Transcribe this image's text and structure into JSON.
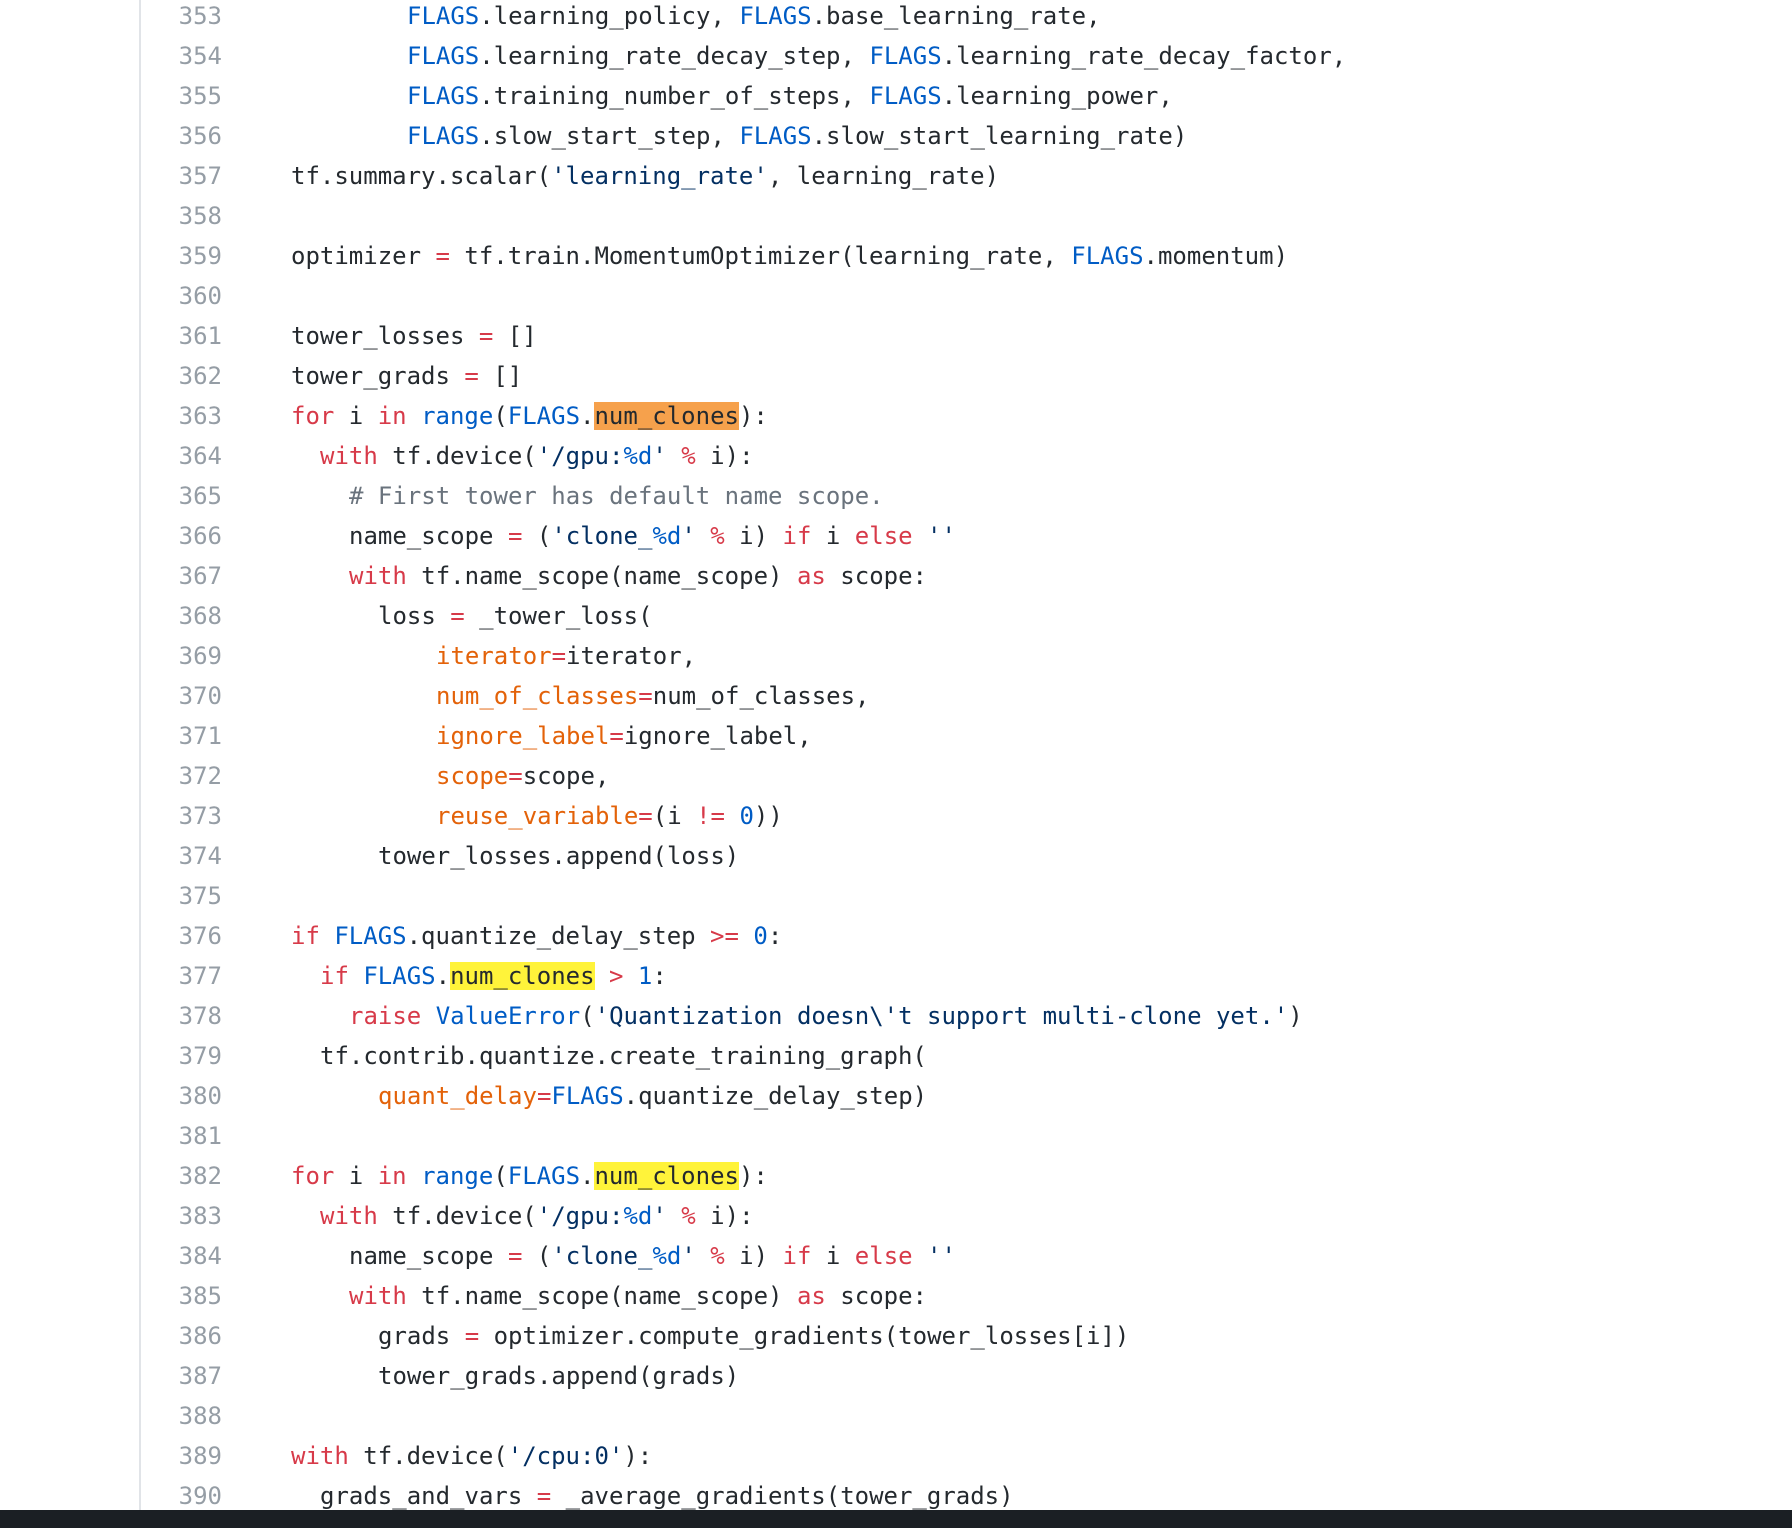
{
  "code_view": {
    "lines": [
      {
        "num": "353",
        "indent": 4,
        "tokens": [
          [
            "n",
            "FLAGS"
          ],
          [
            "",
            "."
          ],
          [
            "",
            "learning_policy, "
          ],
          [
            "n",
            "FLAGS"
          ],
          [
            "",
            ".base_learning_rate,"
          ]
        ]
      },
      {
        "num": "354",
        "indent": 4,
        "tokens": [
          [
            "n",
            "FLAGS"
          ],
          [
            "",
            ".learning_rate_decay_step, "
          ],
          [
            "n",
            "FLAGS"
          ],
          [
            "",
            ".learning_rate_decay_factor,"
          ]
        ]
      },
      {
        "num": "355",
        "indent": 4,
        "tokens": [
          [
            "n",
            "FLAGS"
          ],
          [
            "",
            ".training_number_of_steps, "
          ],
          [
            "n",
            "FLAGS"
          ],
          [
            "",
            ".learning_power,"
          ]
        ]
      },
      {
        "num": "356",
        "indent": 4,
        "tokens": [
          [
            "n",
            "FLAGS"
          ],
          [
            "",
            ".slow_start_step, "
          ],
          [
            "n",
            "FLAGS"
          ],
          [
            "",
            ".slow_start_learning_rate)"
          ]
        ]
      },
      {
        "num": "357",
        "indent": 0,
        "tokens": [
          [
            "",
            "tf.summary.scalar("
          ],
          [
            "s",
            "'learning_rate'"
          ],
          [
            "",
            ", learning_rate)"
          ]
        ]
      },
      {
        "num": "358",
        "indent": 0,
        "tokens": []
      },
      {
        "num": "359",
        "indent": 0,
        "tokens": [
          [
            "",
            "optimizer "
          ],
          [
            "k",
            "="
          ],
          [
            "",
            " tf.train.MomentumOptimizer(learning_rate, "
          ],
          [
            "n",
            "FLAGS"
          ],
          [
            "",
            ".momentum)"
          ]
        ]
      },
      {
        "num": "360",
        "indent": 0,
        "tokens": []
      },
      {
        "num": "361",
        "indent": 0,
        "tokens": [
          [
            "",
            "tower_losses "
          ],
          [
            "k",
            "="
          ],
          [
            "",
            " []"
          ]
        ]
      },
      {
        "num": "362",
        "indent": 0,
        "tokens": [
          [
            "",
            "tower_grads "
          ],
          [
            "k",
            "="
          ],
          [
            "",
            " []"
          ]
        ]
      },
      {
        "num": "363",
        "indent": 0,
        "tokens": [
          [
            "k",
            "for"
          ],
          [
            "",
            " i "
          ],
          [
            "k",
            "in"
          ],
          [
            "",
            " "
          ],
          [
            "n",
            "range"
          ],
          [
            "",
            "("
          ],
          [
            "n",
            "FLAGS"
          ],
          [
            "",
            "."
          ],
          [
            "hl-o",
            "num_clones"
          ],
          [
            "",
            "):"
          ]
        ]
      },
      {
        "num": "364",
        "indent": 1,
        "tokens": [
          [
            "k",
            "with"
          ],
          [
            "",
            " tf.device("
          ],
          [
            "s",
            "'/gpu:"
          ],
          [
            "n",
            "%d"
          ],
          [
            "s",
            "'"
          ],
          [
            "",
            " "
          ],
          [
            "k",
            "%"
          ],
          [
            "",
            " i):"
          ]
        ]
      },
      {
        "num": "365",
        "indent": 2,
        "tokens": [
          [
            "c",
            "# First tower has default name scope."
          ]
        ]
      },
      {
        "num": "366",
        "indent": 2,
        "tokens": [
          [
            "",
            "name_scope "
          ],
          [
            "k",
            "="
          ],
          [
            "",
            " ("
          ],
          [
            "s",
            "'clone_"
          ],
          [
            "n",
            "%d"
          ],
          [
            "s",
            "'"
          ],
          [
            "",
            " "
          ],
          [
            "k",
            "%"
          ],
          [
            "",
            " i) "
          ],
          [
            "k",
            "if"
          ],
          [
            "",
            " i "
          ],
          [
            "k",
            "else"
          ],
          [
            "",
            " "
          ],
          [
            "s",
            "''"
          ]
        ]
      },
      {
        "num": "367",
        "indent": 2,
        "tokens": [
          [
            "k",
            "with"
          ],
          [
            "",
            " tf.name_scope(name_scope) "
          ],
          [
            "k",
            "as"
          ],
          [
            "",
            " scope:"
          ]
        ]
      },
      {
        "num": "368",
        "indent": 3,
        "tokens": [
          [
            "",
            "loss "
          ],
          [
            "k",
            "="
          ],
          [
            "",
            " _tower_loss("
          ]
        ]
      },
      {
        "num": "369",
        "indent": 5,
        "tokens": [
          [
            "p",
            "iterator"
          ],
          [
            "k",
            "="
          ],
          [
            "",
            "iterator,"
          ]
        ]
      },
      {
        "num": "370",
        "indent": 5,
        "tokens": [
          [
            "p",
            "num_of_classes"
          ],
          [
            "k",
            "="
          ],
          [
            "",
            "num_of_classes,"
          ]
        ]
      },
      {
        "num": "371",
        "indent": 5,
        "tokens": [
          [
            "p",
            "ignore_label"
          ],
          [
            "k",
            "="
          ],
          [
            "",
            "ignore_label,"
          ]
        ]
      },
      {
        "num": "372",
        "indent": 5,
        "tokens": [
          [
            "p",
            "scope"
          ],
          [
            "k",
            "="
          ],
          [
            "",
            "scope,"
          ]
        ]
      },
      {
        "num": "373",
        "indent": 5,
        "tokens": [
          [
            "p",
            "reuse_variable"
          ],
          [
            "k",
            "="
          ],
          [
            "",
            "(i "
          ],
          [
            "k",
            "!="
          ],
          [
            "",
            " "
          ],
          [
            "n",
            "0"
          ],
          [
            "",
            "))"
          ]
        ]
      },
      {
        "num": "374",
        "indent": 3,
        "tokens": [
          [
            "",
            "tower_losses.append(loss)"
          ]
        ]
      },
      {
        "num": "375",
        "indent": 0,
        "tokens": []
      },
      {
        "num": "376",
        "indent": 0,
        "tokens": [
          [
            "k",
            "if"
          ],
          [
            "",
            " "
          ],
          [
            "n",
            "FLAGS"
          ],
          [
            "",
            ".quantize_delay_step "
          ],
          [
            "k",
            ">="
          ],
          [
            "",
            " "
          ],
          [
            "n",
            "0"
          ],
          [
            "",
            ":"
          ]
        ]
      },
      {
        "num": "377",
        "indent": 1,
        "tokens": [
          [
            "k",
            "if"
          ],
          [
            "",
            " "
          ],
          [
            "n",
            "FLAGS"
          ],
          [
            "",
            "."
          ],
          [
            "hl-y",
            "num_clones"
          ],
          [
            "",
            " "
          ],
          [
            "k",
            ">"
          ],
          [
            "",
            " "
          ],
          [
            "n",
            "1"
          ],
          [
            "",
            ":"
          ]
        ]
      },
      {
        "num": "378",
        "indent": 2,
        "tokens": [
          [
            "k",
            "raise"
          ],
          [
            "",
            " "
          ],
          [
            "n",
            "ValueError"
          ],
          [
            "",
            "("
          ],
          [
            "s",
            "'Quantization doesn\\'t support multi-clone yet.'"
          ],
          [
            "",
            ")"
          ]
        ]
      },
      {
        "num": "379",
        "indent": 1,
        "tokens": [
          [
            "",
            "tf.contrib.quantize.create_training_graph("
          ]
        ]
      },
      {
        "num": "380",
        "indent": 3,
        "tokens": [
          [
            "p",
            "quant_delay"
          ],
          [
            "k",
            "="
          ],
          [
            "n",
            "FLAGS"
          ],
          [
            "",
            ".quantize_delay_step)"
          ]
        ]
      },
      {
        "num": "381",
        "indent": 0,
        "tokens": []
      },
      {
        "num": "382",
        "indent": 0,
        "tokens": [
          [
            "k",
            "for"
          ],
          [
            "",
            " i "
          ],
          [
            "k",
            "in"
          ],
          [
            "",
            " "
          ],
          [
            "n",
            "range"
          ],
          [
            "",
            "("
          ],
          [
            "n",
            "FLAGS"
          ],
          [
            "",
            "."
          ],
          [
            "hl-y",
            "num_clones"
          ],
          [
            "",
            "):"
          ]
        ]
      },
      {
        "num": "383",
        "indent": 1,
        "tokens": [
          [
            "k",
            "with"
          ],
          [
            "",
            " tf.device("
          ],
          [
            "s",
            "'/gpu:"
          ],
          [
            "n",
            "%d"
          ],
          [
            "s",
            "'"
          ],
          [
            "",
            " "
          ],
          [
            "k",
            "%"
          ],
          [
            "",
            " i):"
          ]
        ]
      },
      {
        "num": "384",
        "indent": 2,
        "tokens": [
          [
            "",
            "name_scope "
          ],
          [
            "k",
            "="
          ],
          [
            "",
            " ("
          ],
          [
            "s",
            "'clone_"
          ],
          [
            "n",
            "%d"
          ],
          [
            "s",
            "'"
          ],
          [
            "",
            " "
          ],
          [
            "k",
            "%"
          ],
          [
            "",
            " i) "
          ],
          [
            "k",
            "if"
          ],
          [
            "",
            " i "
          ],
          [
            "k",
            "else"
          ],
          [
            "",
            " "
          ],
          [
            "s",
            "''"
          ]
        ]
      },
      {
        "num": "385",
        "indent": 2,
        "tokens": [
          [
            "k",
            "with"
          ],
          [
            "",
            " tf.name_scope(name_scope) "
          ],
          [
            "k",
            "as"
          ],
          [
            "",
            " scope:"
          ]
        ]
      },
      {
        "num": "386",
        "indent": 3,
        "tokens": [
          [
            "",
            "grads "
          ],
          [
            "k",
            "="
          ],
          [
            "",
            " optimizer.compute_gradients(tower_losses[i])"
          ]
        ]
      },
      {
        "num": "387",
        "indent": 3,
        "tokens": [
          [
            "",
            "tower_grads.append(grads)"
          ]
        ]
      },
      {
        "num": "388",
        "indent": 0,
        "tokens": []
      },
      {
        "num": "389",
        "indent": 0,
        "tokens": [
          [
            "k",
            "with"
          ],
          [
            "",
            " tf.device("
          ],
          [
            "s",
            "'/cpu:0'"
          ],
          [
            "",
            "):"
          ]
        ]
      },
      {
        "num": "390",
        "indent": 1,
        "tokens": [
          [
            "",
            "grads_and_vars "
          ],
          [
            "k",
            "="
          ],
          [
            "",
            " _average_gradients(tower_grads)"
          ]
        ]
      }
    ]
  }
}
